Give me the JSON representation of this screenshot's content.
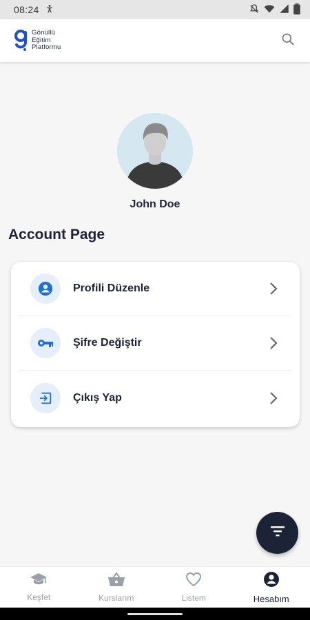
{
  "status_bar": {
    "time": "08:24",
    "icons": [
      "accessibility-icon",
      "mute-icon",
      "wifi-icon",
      "signal-icon",
      "battery-icon"
    ]
  },
  "header": {
    "logo_lines": [
      "Gönüllü",
      "Eğitim",
      "Platformu"
    ],
    "logo_color": "#1f4fd8",
    "search_icon": "search-icon"
  },
  "profile": {
    "name": "John Doe"
  },
  "page": {
    "title": "Account Page"
  },
  "menu": {
    "items": [
      {
        "label": "Profili Düzenle",
        "icon": "account-circle-icon"
      },
      {
        "label": "Şifre Değiştir",
        "icon": "key-icon"
      },
      {
        "label": "Çıkış Yap",
        "icon": "logout-icon"
      }
    ]
  },
  "fab": {
    "icon": "filter-icon"
  },
  "bottom_nav": {
    "items": [
      {
        "label": "Keşfet",
        "icon": "graduation-cap-icon",
        "active": false
      },
      {
        "label": "Kurslarım",
        "icon": "basket-icon",
        "active": false
      },
      {
        "label": "Listem",
        "icon": "heart-icon",
        "active": false
      },
      {
        "label": "Hesabım",
        "icon": "account-icon",
        "active": true
      }
    ]
  },
  "colors": {
    "primary_dark": "#1d2337",
    "accent_blue": "#1f6fd8",
    "icon_bg": "#e6eefa",
    "inactive": "#9aa0a6"
  }
}
